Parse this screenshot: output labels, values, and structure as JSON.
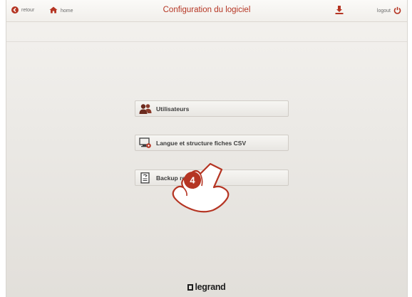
{
  "header": {
    "back_label": "retour",
    "home_label": "home",
    "title": "Configuration du logiciel",
    "logout_label": "logout",
    "download_icon": "download-icon"
  },
  "menu": {
    "items": [
      {
        "label": "Utilisateurs",
        "icon": "users-icon"
      },
      {
        "label": "Langue et structure fiches CSV",
        "icon": "monitor-settings-icon"
      },
      {
        "label": "Backup restore",
        "icon": "backup-document-icon"
      }
    ]
  },
  "overlay": {
    "step_number": "4",
    "icon": "pointing-hand-icon"
  },
  "footer": {
    "brand": "legrand"
  },
  "colors": {
    "accent": "#b53523",
    "text": "#3c3c3c",
    "background": "#ebe9e5"
  }
}
